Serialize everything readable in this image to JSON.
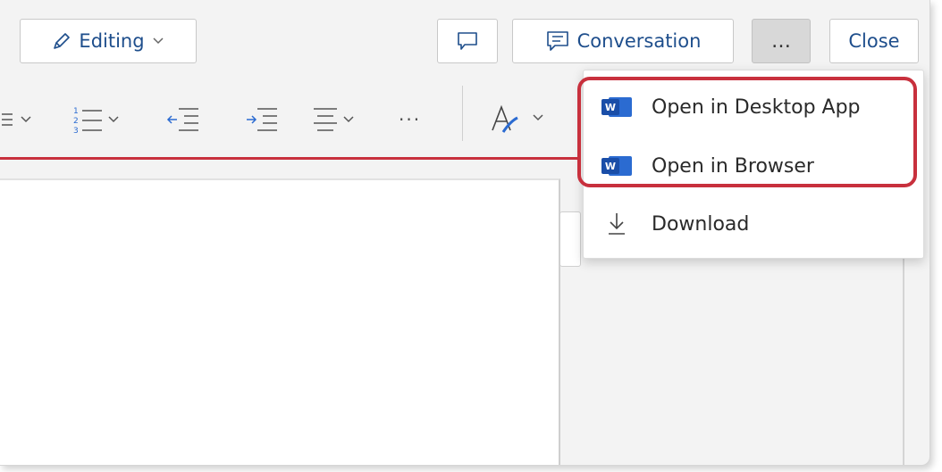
{
  "toolbar": {
    "editing_label": "Editing",
    "conversation_label": "Conversation",
    "more_label": "…",
    "close_label": "Close"
  },
  "format_row": {
    "more_label": "···"
  },
  "menu": {
    "items": [
      {
        "label": "Open in Desktop App",
        "icon": "word-icon"
      },
      {
        "label": "Open in Browser",
        "icon": "word-icon"
      },
      {
        "label": "Download",
        "icon": "download-icon"
      }
    ]
  },
  "colors": {
    "accent": "#1e4e8c",
    "highlight": "#c8303d",
    "word_blue": "#2b6bd1"
  }
}
